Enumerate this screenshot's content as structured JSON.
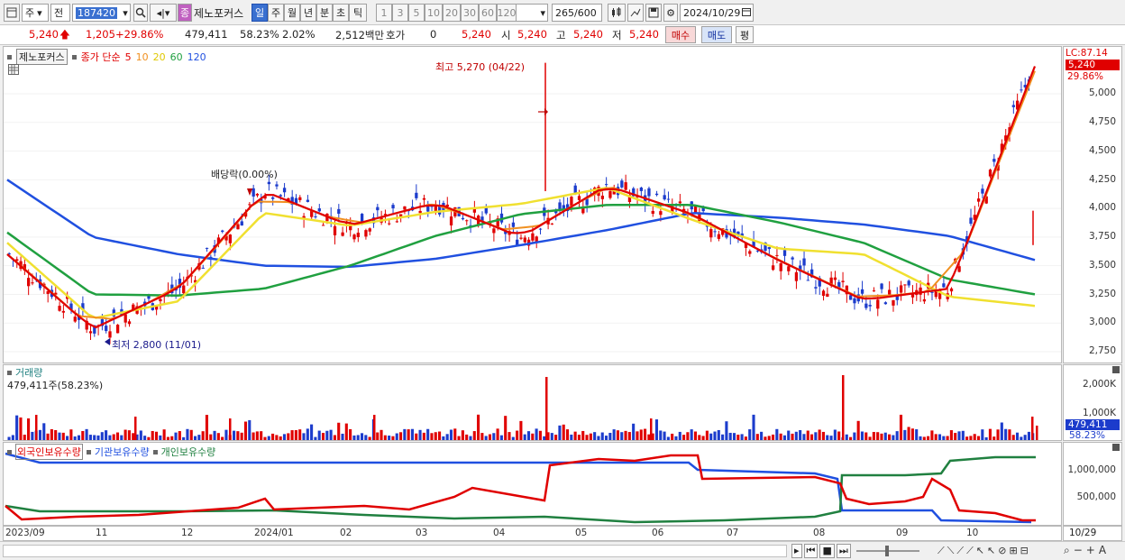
{
  "toolbar": {
    "market": "주",
    "mode": "전",
    "code": "187420",
    "stock_name": "제노포커스",
    "periods": [
      "일",
      "주",
      "월",
      "년",
      "분",
      "초",
      "틱"
    ],
    "intervals": [
      "1",
      "3",
      "5",
      "10",
      "20",
      "30",
      "60",
      "120"
    ],
    "count": "265",
    "count_total": "/600",
    "date": "2024/10/29"
  },
  "quote": {
    "price": "5,240",
    "change": "1,205",
    "change_pct": "+29.86%",
    "volume": "479,411",
    "vol_ratio": "58.23%",
    "turnover_ratio": "2.02%",
    "amount": "2,512백만",
    "hoga_label": "호가",
    "hoga_value": "0",
    "price2": "5,240",
    "open_label": "시",
    "open": "5,240",
    "high_label": "고",
    "high": "5,240",
    "low_label": "저",
    "low": "5,240",
    "buy_label": "매수",
    "sell_label": "매도",
    "avg_label": "평"
  },
  "price_panel": {
    "legend_name": "제노포커스",
    "legend_ma_label": "종가 단순",
    "legend_ma": [
      "5",
      "10",
      "20",
      "60",
      "120"
    ],
    "high_annotation": "최고 5,270 (04/22)",
    "low_annotation": "최저 2,800 (11/01)",
    "dividend_annotation": "배당락(0.00%)",
    "lc_label": "LC:87.14",
    "last_price_tag": "5,240",
    "last_pct_tag": "29.86%",
    "yticks": [
      "5,000",
      "4,750",
      "4,500",
      "4,250",
      "4,000",
      "3,750",
      "3,500",
      "3,250",
      "3,000",
      "2,750"
    ]
  },
  "volume_panel": {
    "title": "거래량",
    "info": "479,411주(58.23%)",
    "yticks": [
      "2,000K",
      "1,000K"
    ],
    "last_tag": "479,411",
    "last_pct": "58.23%"
  },
  "holding_panel": {
    "legends": [
      "외국인보유수량",
      "기관보유수량",
      "개인보유수량"
    ],
    "yticks": [
      "1,000,000",
      "500,000"
    ]
  },
  "xaxis": {
    "labels": [
      "2023/09",
      "11",
      "12",
      "2024/01",
      "02",
      "03",
      "04",
      "05",
      "06",
      "07",
      "08",
      "09",
      "10"
    ],
    "current": "10/29"
  },
  "colors": {
    "up": "#e00000",
    "down": "#1c3ccc",
    "ma5": "#e00000",
    "ma10": "#f09020",
    "ma20": "#f0e030",
    "ma60": "#20a040",
    "ma120": "#2050e0"
  },
  "chart_data": {
    "type": "line",
    "title": "제노포커스",
    "series_ma": [
      {
        "name": "5",
        "color": "#e00000"
      },
      {
        "name": "10",
        "color": "#f09020"
      },
      {
        "name": "20",
        "color": "#f0e030"
      },
      {
        "name": "60",
        "color": "#20a040"
      },
      {
        "name": "120",
        "color": "#2050e0"
      }
    ],
    "ylim": [
      2650,
      5250
    ],
    "x": [
      "2023/09",
      "11",
      "12",
      "2024/01",
      "02",
      "03",
      "04",
      "05",
      "06",
      "07",
      "08",
      "09",
      "10"
    ],
    "ma120": [
      4250,
      3750,
      3600,
      3500,
      3490,
      3560,
      3680,
      3810,
      3960,
      3920,
      3860,
      3760,
      3550
    ],
    "ma60": [
      3790,
      3250,
      3240,
      3300,
      3500,
      3760,
      3950,
      4030,
      4030,
      3880,
      3700,
      3380,
      3250
    ],
    "ma20": [
      3700,
      3040,
      3190,
      3960,
      3850,
      3970,
      4040,
      4180,
      3900,
      3650,
      3600,
      3230,
      3150
    ],
    "close_approx": [
      3600,
      2950,
      3300,
      4150,
      3850,
      4050,
      3750,
      4200,
      3950,
      3550,
      3200,
      3300,
      5240
    ]
  }
}
